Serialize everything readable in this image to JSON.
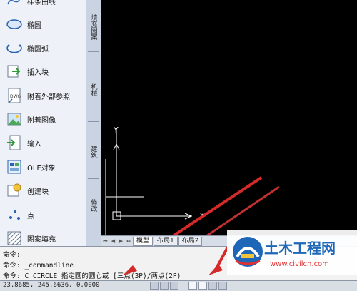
{
  "palette": {
    "items": [
      {
        "label": "样条曲线",
        "icon": "spline-icon"
      },
      {
        "label": "椭圆",
        "icon": "ellipse-icon"
      },
      {
        "label": "椭圆弧",
        "icon": "elliptical-arc-icon"
      },
      {
        "label": "插入块",
        "icon": "insert-block-icon"
      },
      {
        "label": "附着外部参照",
        "icon": "attach-xref-icon"
      },
      {
        "label": "附着图像",
        "icon": "attach-image-icon"
      },
      {
        "label": "输入",
        "icon": "import-icon"
      },
      {
        "label": "OLE对象",
        "icon": "ole-object-icon"
      },
      {
        "label": "创建块",
        "icon": "create-block-icon"
      },
      {
        "label": "点",
        "icon": "point-icon"
      },
      {
        "label": "图案填充",
        "icon": "hatch-icon"
      }
    ],
    "tabs": [
      "填充图案",
      "机械",
      "建筑",
      "修改"
    ]
  },
  "drawing": {
    "ucs": {
      "x_label": "X",
      "y_label": "Y"
    }
  },
  "layout_tabs": [
    "模型",
    "布局1",
    "布局2"
  ],
  "command": {
    "lines": [
      "命令:",
      "命令: _commandline",
      "命令: C CIRCLE 指定圆的圆心或 [三点(3P)/两点(2P)"
    ]
  },
  "status": {
    "coordinates": "23.8685, 245.6636, 0.0000"
  },
  "watermark": {
    "name": "土木工程网",
    "url": "www.civilcn.com"
  },
  "colors": {
    "drawing_bg": "#000000",
    "annotation_arrow": "#d42a2a",
    "watermark_blue": "#1e67b8",
    "watermark_red": "#e03030"
  }
}
